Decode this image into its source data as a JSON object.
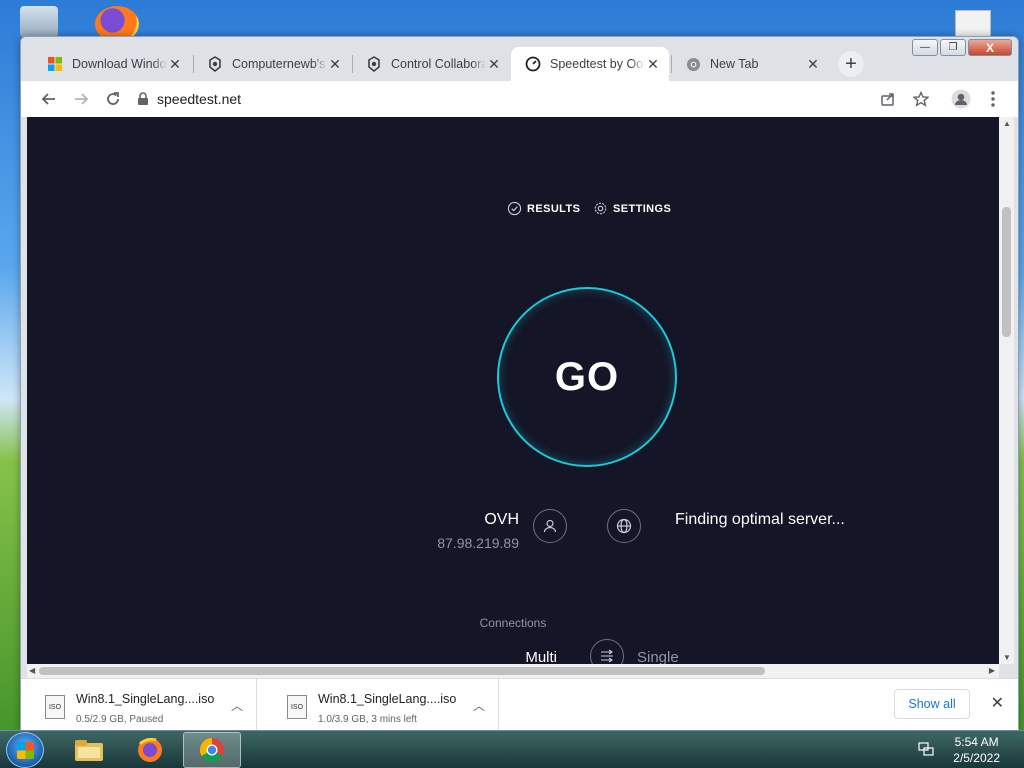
{
  "browser": {
    "tabs": [
      {
        "label": "Download Windows",
        "icon": "windows-logo-icon",
        "close": "✕"
      },
      {
        "label": "Computernewb's",
        "icon": "computernewb-icon",
        "close": "✕"
      },
      {
        "label": "Control Collaborative",
        "icon": "computernewb-icon",
        "close": "✕"
      },
      {
        "label": "Speedtest by Ookla",
        "icon": "speedtest-icon",
        "close": "✕"
      },
      {
        "label": "New Tab",
        "icon": "chrome-icon",
        "close": "✕"
      }
    ],
    "new_tab": "+",
    "window_controls": {
      "minimize": "—",
      "maximize": "❐",
      "close": "X"
    },
    "url": "speedtest.net"
  },
  "speedtest": {
    "results_label": "RESULTS",
    "settings_label": "SETTINGS",
    "go_label": "GO",
    "isp_name": "OVH",
    "isp_ip": "87.98.219.89",
    "server_status": "Finding optimal server...",
    "connections_label": "Connections",
    "multi_label": "Multi",
    "single_label": "Single",
    "accent_color": "#1ec8d9"
  },
  "downloads": [
    {
      "name": "Win8.1_SingleLang....iso",
      "status": "0.5/2.9 GB, Paused"
    },
    {
      "name": "Win8.1_SingleLang....iso",
      "status": "1.0/3.9 GB, 3 mins left"
    }
  ],
  "download_shelf": {
    "show_all": "Show all",
    "close": "✕"
  },
  "taskbar": {
    "time": "5:54 AM",
    "date": "2/5/2022"
  }
}
